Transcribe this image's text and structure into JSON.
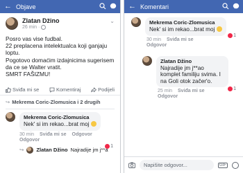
{
  "left": {
    "topbar_title": "Objave",
    "post": {
      "author": "Zlatan Džino",
      "time": "26 min",
      "text": "Posro vas vise fudbal.\n22 preplacena intelektualca koji ganjaju loptu.\nPogotovo domaćim izdajnicima sugerisem da ce se Walter vratit.\nSMRT FAŠIZMU!"
    },
    "actions": {
      "like": "Sviđa mi se",
      "comment": "Komentiraj",
      "share": "Podijeli"
    },
    "reply_summary": "Mekrema Coric-Zlomusica i 2 drugih",
    "comment": {
      "author": "Mekrema Coric-Zlomusica",
      "text": "Nek' si im rekao...brat moj",
      "time": "30 min",
      "like": "Sviđa mi se",
      "reply": "Odgovor",
      "reaction_count": "1"
    },
    "reply_preview": {
      "author": "Zlatan Džino",
      "text": "Najradije jm j**a"
    }
  },
  "right": {
    "topbar_title": "Komentari",
    "comment": {
      "author": "Mekrema Coric-Zlomusica",
      "text": "Nek' si im rekao...brat moj",
      "time": "30 min",
      "like": "Sviđa mi se",
      "reply": "Odgovor",
      "reaction_count": "1"
    },
    "reply": {
      "author": "Zlatan Džino",
      "text": "Najradije jm j**ao komplet familiju svima. I na Goli otok začer'o.",
      "time": "25 min",
      "like": "Sviđa mi se",
      "reply": "Odgovor",
      "reaction_count": "1"
    },
    "composer_placeholder": "Napišite odgovor..."
  },
  "colors": {
    "brand": "#4267b2",
    "bubble": "#f2f3f5",
    "meta": "#90949c",
    "reaction_heart": "#f02849"
  }
}
